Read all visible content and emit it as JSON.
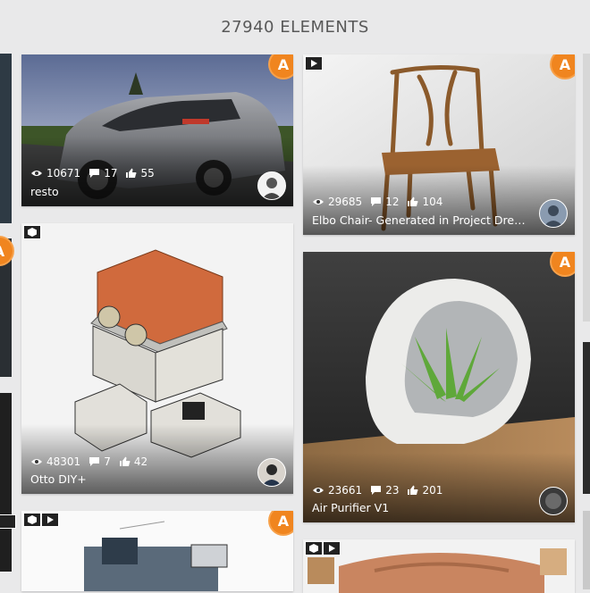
{
  "header": {
    "title": "27940 ELEMENTS"
  },
  "badge_letter": "A",
  "colors": {
    "badge": "#f0851f",
    "background": "#e9e9ea",
    "text": "#595959"
  },
  "cards": [
    {
      "name": "card-resto",
      "views": "10671",
      "comments": "17",
      "likes": "55",
      "title": "resto"
    },
    {
      "name": "card-elbo-chair",
      "views": "29685",
      "comments": "12",
      "likes": "104",
      "title": "Elbo Chair- Generated in Project Drea…"
    },
    {
      "name": "card-otto-diy",
      "views": "48301",
      "comments": "7",
      "likes": "42",
      "title": "Otto DIY+"
    },
    {
      "name": "card-air-purifier",
      "views": "23661",
      "comments": "23",
      "likes": "201",
      "title": "Air Purifier V1"
    }
  ],
  "icons": {
    "eye": "eye-icon",
    "comment": "comment-icon",
    "like": "thumbs-up-icon",
    "badge": "autodesk-badge-icon",
    "video": "video-icon",
    "cube": "cube-icon"
  }
}
